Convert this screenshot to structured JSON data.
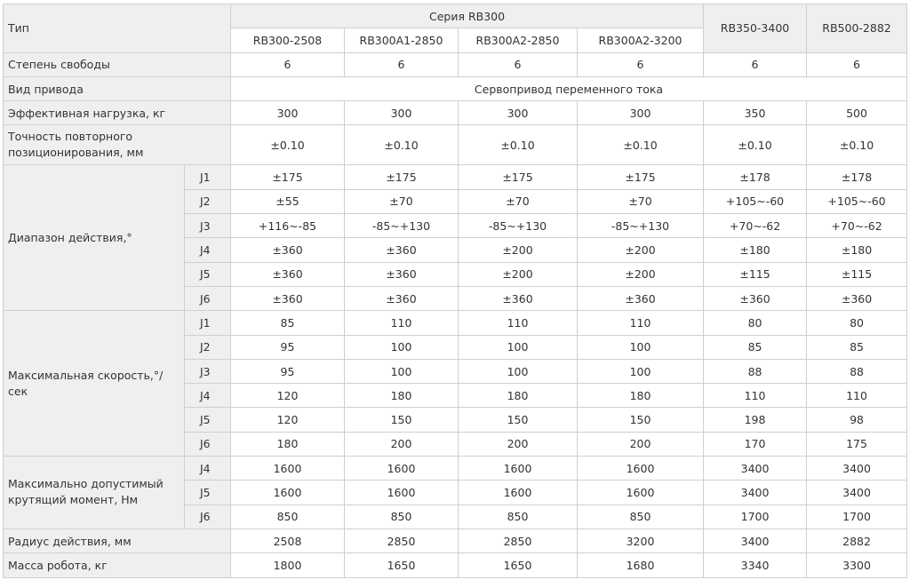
{
  "header": {
    "type_label": "Тип",
    "series_label": "Серия RB300",
    "series_models": [
      "RB300-2508",
      "RB300A1-2850",
      "RB300A2-2850",
      "RB300A2-3200"
    ],
    "other_models": [
      "RB350-3400",
      "RB500-2882"
    ]
  },
  "dof": {
    "label": "Степень свободы",
    "values": [
      "6",
      "6",
      "6",
      "6",
      "6",
      "6"
    ]
  },
  "drive": {
    "label": "Вид привода",
    "value": "Сервопривод переменного тока"
  },
  "payload": {
    "label": "Эффективная нагрузка, кг",
    "values": [
      "300",
      "300",
      "300",
      "300",
      "350",
      "500"
    ]
  },
  "repeatability": {
    "label": "Точность повторного позиционирования, мм",
    "values": [
      "±0.10",
      "±0.10",
      "±0.10",
      "±0.10",
      "±0.10",
      "±0.10"
    ]
  },
  "range": {
    "label": "Диапазон действия,°",
    "rows": [
      {
        "axis": "J1",
        "values": [
          "±175",
          "±175",
          "±175",
          "±175",
          "±178",
          "±178"
        ]
      },
      {
        "axis": "J2",
        "values": [
          "±55",
          "±70",
          "±70",
          "±70",
          "+105~-60",
          "+105~-60"
        ]
      },
      {
        "axis": "J3",
        "values": [
          "+116~-85",
          "-85~+130",
          "-85~+130",
          "-85~+130",
          "+70~-62",
          "+70~-62"
        ]
      },
      {
        "axis": "J4",
        "values": [
          "±360",
          "±360",
          "±200",
          "±200",
          "±180",
          "±180"
        ]
      },
      {
        "axis": "J5",
        "values": [
          "±360",
          "±360",
          "±200",
          "±200",
          "±115",
          "±115"
        ]
      },
      {
        "axis": "J6",
        "values": [
          "±360",
          "±360",
          "±360",
          "±360",
          "±360",
          "±360"
        ]
      }
    ]
  },
  "speed": {
    "label": "Максимальная скорость,°/сек",
    "rows": [
      {
        "axis": "J1",
        "values": [
          "85",
          "110",
          "110",
          "110",
          "80",
          "80"
        ]
      },
      {
        "axis": "J2",
        "values": [
          "95",
          "100",
          "100",
          "100",
          "85",
          "85"
        ]
      },
      {
        "axis": "J3",
        "values": [
          "95",
          "100",
          "100",
          "100",
          "88",
          "88"
        ]
      },
      {
        "axis": "J4",
        "values": [
          "120",
          "180",
          "180",
          "180",
          "110",
          "110"
        ]
      },
      {
        "axis": "J5",
        "values": [
          "120",
          "150",
          "150",
          "150",
          "198",
          "98"
        ]
      },
      {
        "axis": "J6",
        "values": [
          "180",
          "200",
          "200",
          "200",
          "170",
          "175"
        ]
      }
    ]
  },
  "torque": {
    "label": "Максимально допустимый крутящий момент, Нм",
    "rows": [
      {
        "axis": "J4",
        "values": [
          "1600",
          "1600",
          "1600",
          "1600",
          "3400",
          "3400"
        ]
      },
      {
        "axis": "J5",
        "values": [
          "1600",
          "1600",
          "1600",
          "1600",
          "3400",
          "3400"
        ]
      },
      {
        "axis": "J6",
        "values": [
          "850",
          "850",
          "850",
          "850",
          "1700",
          "1700"
        ]
      }
    ]
  },
  "reach": {
    "label": "Радиус действия, мм",
    "values": [
      "2508",
      "2850",
      "2850",
      "3200",
      "3400",
      "2882"
    ]
  },
  "mass": {
    "label": "Масса робота, кг",
    "values": [
      "1800",
      "1650",
      "1650",
      "1680",
      "3340",
      "3300"
    ]
  }
}
